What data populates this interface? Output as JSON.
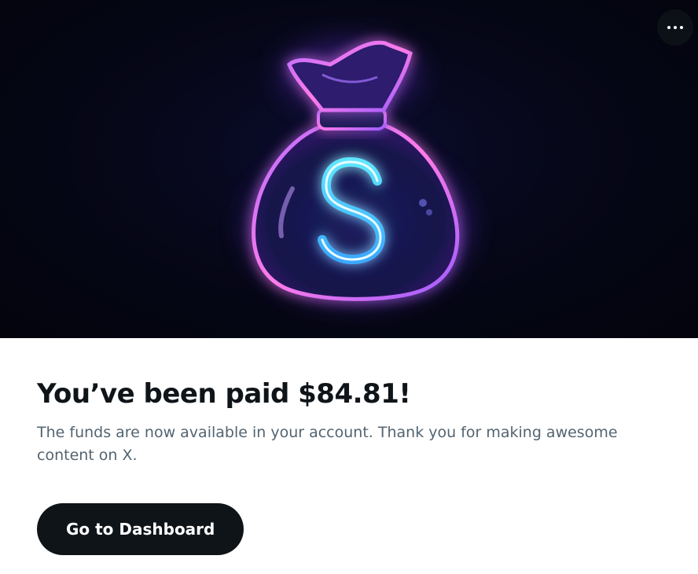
{
  "hero": {
    "image_icon": "money-bag-dollar-icon",
    "more_icon": "ellipsis-horizontal-icon"
  },
  "main": {
    "title": "You’ve been paid $84.81!",
    "description": "The funds are now available in your account. Thank you for making awesome content on X."
  },
  "cta": {
    "label": "Go to Dashboard"
  },
  "colors": {
    "text_primary": "#0f1419",
    "text_secondary": "#536471",
    "button_bg": "#0f1419",
    "neon_pink": "#d25cff",
    "neon_cyan": "#3fd8ff"
  }
}
